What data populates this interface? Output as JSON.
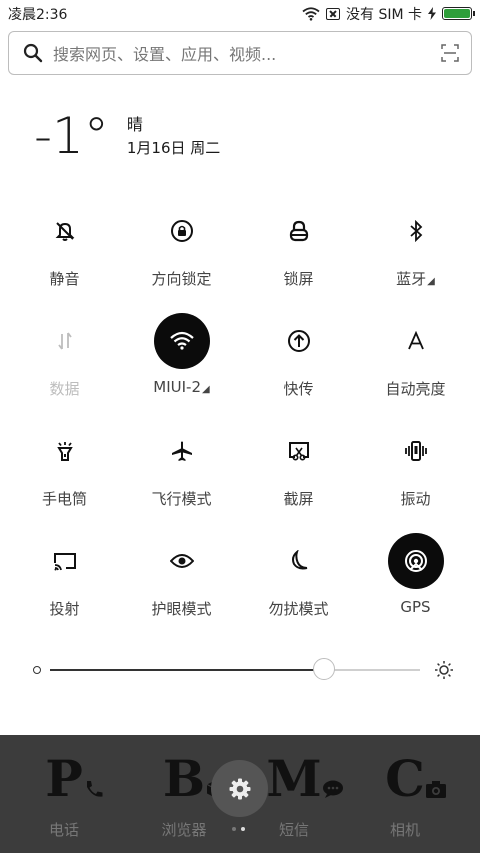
{
  "status_bar": {
    "time": "凌晨2:36",
    "no_sim_text": "没有 SIM 卡",
    "wifi_icon": "wifi-icon",
    "battery_level": 1.0,
    "battery_color": "#2e9e3a"
  },
  "search": {
    "placeholder": "搜索网页、设置、应用、视频..."
  },
  "weather": {
    "temperature": "-1°",
    "condition": "晴",
    "date": "1月16日 周二"
  },
  "tiles": [
    {
      "label": "静音",
      "icon": "bell-off-icon",
      "active": false
    },
    {
      "label": "方向锁定",
      "icon": "rotation-lock-icon",
      "active": false
    },
    {
      "label": "锁屏",
      "icon": "lock-icon",
      "active": false
    },
    {
      "label": "蓝牙",
      "icon": "bluetooth-icon",
      "active": false
    },
    {
      "label": "数据",
      "icon": "mobile-data-icon",
      "active": false
    },
    {
      "label": "MIUI-2",
      "icon": "wifi-icon",
      "active": true
    },
    {
      "label": "快传",
      "icon": "transfer-icon",
      "active": false
    },
    {
      "label": "自动亮度",
      "icon": "auto-brightness-icon",
      "active": false
    },
    {
      "label": "手电筒",
      "icon": "flashlight-icon",
      "active": false
    },
    {
      "label": "飞行模式",
      "icon": "airplane-icon",
      "active": false
    },
    {
      "label": "截屏",
      "icon": "screenshot-icon",
      "active": false
    },
    {
      "label": "振动",
      "icon": "vibrate-icon",
      "active": false
    },
    {
      "label": "投射",
      "icon": "cast-icon",
      "active": false
    },
    {
      "label": "护眼模式",
      "icon": "eye-icon",
      "active": false
    },
    {
      "label": "勿扰模式",
      "icon": "moon-icon",
      "active": false
    },
    {
      "label": "GPS",
      "icon": "gps-icon",
      "active": true
    }
  ],
  "brightness": {
    "level": 0.74
  },
  "dock": {
    "apps": [
      {
        "label": "电话",
        "glyph": "P",
        "icon": "phone-icon"
      },
      {
        "label": "浏览器",
        "glyph": "B",
        "icon": "browser-icon"
      },
      {
        "label": "短信",
        "glyph": "M",
        "icon": "message-icon"
      },
      {
        "label": "相机",
        "glyph": "C",
        "icon": "camera-icon"
      }
    ],
    "settings_icon": "gear-icon",
    "pages": 2,
    "current_page": 2
  }
}
